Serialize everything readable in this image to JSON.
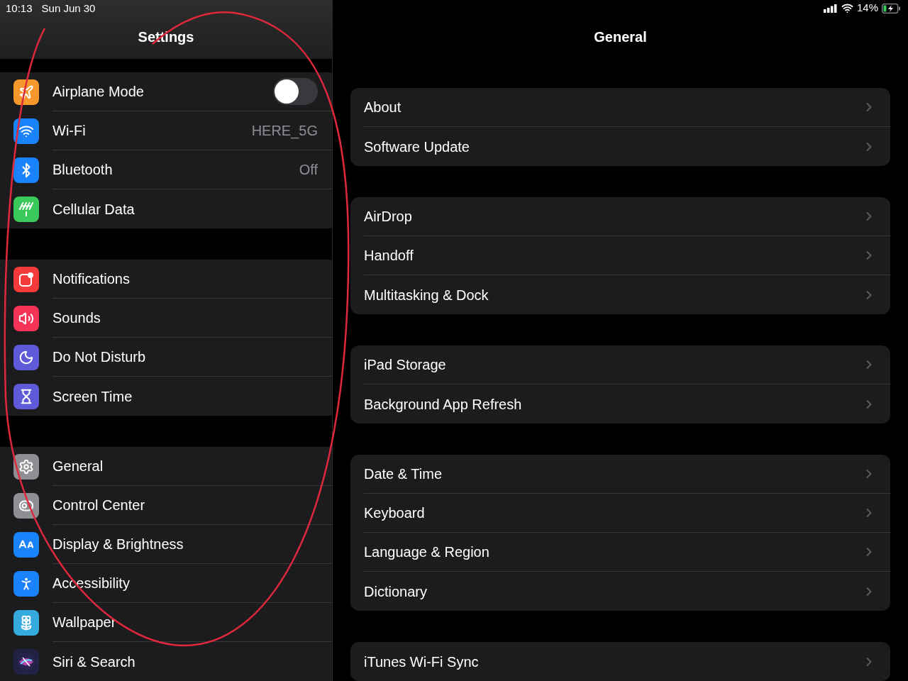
{
  "status_bar": {
    "time": "10:13",
    "date": "Sun Jun 30",
    "battery": "14%"
  },
  "sidebar": {
    "title": "Settings",
    "groups": [
      [
        {
          "label": "Airplane Mode",
          "kind": "toggle",
          "on": false,
          "color": "#f7982c"
        },
        {
          "label": "Wi-Fi",
          "kind": "value",
          "value": "HERE_5G",
          "color": "#1a82fb"
        },
        {
          "label": "Bluetooth",
          "kind": "value",
          "value": "Off",
          "color": "#1a82fb"
        },
        {
          "label": "Cellular Data",
          "kind": "plain",
          "color": "#3bc95b"
        }
      ],
      [
        {
          "label": "Notifications",
          "kind": "plain",
          "color": "#f43b3a"
        },
        {
          "label": "Sounds",
          "kind": "plain",
          "color": "#f53458"
        },
        {
          "label": "Do Not Disturb",
          "kind": "plain",
          "color": "#5e5ad8"
        },
        {
          "label": "Screen Time",
          "kind": "plain",
          "color": "#5e5ad8"
        }
      ],
      [
        {
          "label": "General",
          "kind": "plain",
          "color": "#8e8e93"
        },
        {
          "label": "Control Center",
          "kind": "plain",
          "color": "#8e8e93"
        },
        {
          "label": "Display & Brightness",
          "kind": "plain",
          "color": "#1a82fb"
        },
        {
          "label": "Accessibility",
          "kind": "plain",
          "color": "#1a82fb"
        },
        {
          "label": "Wallpaper",
          "kind": "plain",
          "color": "#35aadc"
        },
        {
          "label": "Siri & Search",
          "kind": "plain",
          "color": "#222244"
        }
      ]
    ]
  },
  "detail": {
    "title": "General",
    "groups": [
      [
        "About",
        "Software Update"
      ],
      [
        "AirDrop",
        "Handoff",
        "Multitasking & Dock"
      ],
      [
        "iPad Storage",
        "Background App Refresh"
      ],
      [
        "Date & Time",
        "Keyboard",
        "Language & Region",
        "Dictionary"
      ],
      [
        "iTunes Wi-Fi Sync"
      ]
    ]
  }
}
